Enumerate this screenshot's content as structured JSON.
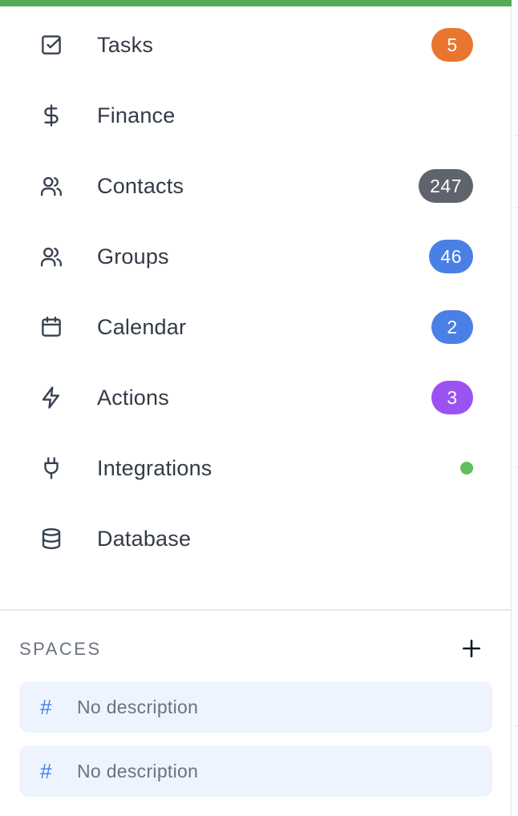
{
  "nav": {
    "items": [
      {
        "label": "Tasks",
        "icon": "check-square-icon",
        "badge": "5",
        "badge_color": "#e9762f"
      },
      {
        "label": "Finance",
        "icon": "dollar-icon"
      },
      {
        "label": "Contacts",
        "icon": "users-icon",
        "badge": "247",
        "badge_color": "#5f636b"
      },
      {
        "label": "Groups",
        "icon": "users-icon",
        "badge": "46",
        "badge_color": "#4a7fe6"
      },
      {
        "label": "Calendar",
        "icon": "calendar-icon",
        "badge": "2",
        "badge_color": "#4a7fe6"
      },
      {
        "label": "Actions",
        "icon": "zap-icon",
        "badge": "3",
        "badge_color": "#9a53f0"
      },
      {
        "label": "Integrations",
        "icon": "plug-icon",
        "status_dot_color": "#5fbf5c"
      },
      {
        "label": "Database",
        "icon": "database-icon"
      }
    ]
  },
  "spaces": {
    "title": "SPACES",
    "add_icon": "plus-icon",
    "items": [
      {
        "hash": "#",
        "label": "No description"
      },
      {
        "hash": "#",
        "label": "No description"
      }
    ]
  },
  "colors": {
    "accent_bar": "#58a955",
    "space_bg": "#eef4fd",
    "hash": "#3b82f6"
  }
}
